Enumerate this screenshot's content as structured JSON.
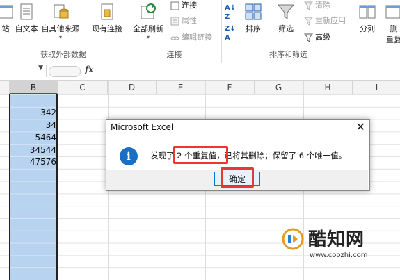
{
  "ribbon": {
    "get_external": {
      "buttons": [
        "站",
        "自文本",
        "自其他来源",
        "现有连接"
      ],
      "label": "获取外部数据"
    },
    "connections": {
      "refresh_all": "全部刷新",
      "connect": "连接",
      "properties": "属性",
      "edit_links": "编辑链接",
      "label": "连接"
    },
    "sort_filter": {
      "sort": "排序",
      "filter": "筛选",
      "clear": "清除",
      "reapply": "重新应用",
      "advanced": "高级",
      "label": "排序和筛选"
    },
    "data_tools": {
      "split": "分列",
      "remove": "删",
      "remove2": "重复"
    }
  },
  "formula_bar": {
    "fx": "fx"
  },
  "columns": [
    "B",
    "C",
    "D",
    "E",
    "F",
    "G",
    "H",
    "I"
  ],
  "cells": [
    "342",
    "34",
    "5464",
    "34544",
    "47576"
  ],
  "dialog": {
    "title": "Microsoft Excel",
    "close": "✕",
    "icon": "i",
    "message": "发现了 2 个重复值，已将其删除；保留了 6 个唯一值。",
    "ok": "确定"
  },
  "watermark": {
    "brand": "酷知网",
    "url": "www.coozhi.com"
  }
}
